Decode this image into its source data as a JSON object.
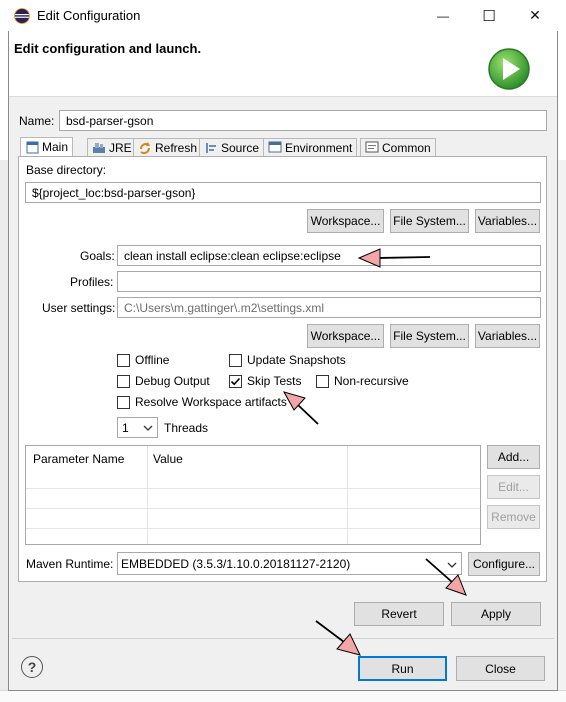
{
  "window": {
    "title": "Edit Configuration",
    "minimize_glyph": "—",
    "maximize_glyph": "☐",
    "close_glyph": "✕"
  },
  "header": {
    "title": "Edit configuration and launch."
  },
  "name": {
    "label": "Name:",
    "value": "bsd-parser-gson"
  },
  "tabs": [
    {
      "label": "Main",
      "icon": "main-tab-icon"
    },
    {
      "label": "JRE",
      "icon": "jre-icon"
    },
    {
      "label": "Refresh",
      "icon": "refresh-icon"
    },
    {
      "label": "Source",
      "icon": "source-icon"
    },
    {
      "label": "Environment",
      "icon": "environment-icon"
    },
    {
      "label": "Common",
      "icon": "common-icon"
    }
  ],
  "base_directory": {
    "label": "Base directory:",
    "value": "${project_loc:bsd-parser-gson}",
    "workspace_btn": "Workspace...",
    "filesystem_btn": "File System...",
    "variables_btn": "Variables..."
  },
  "goals": {
    "label": "Goals:",
    "value": "clean install eclipse:clean eclipse:eclipse"
  },
  "profiles": {
    "label": "Profiles:",
    "value": ""
  },
  "user_settings": {
    "label": "User settings:",
    "value": "C:\\Users\\m.gattinger\\.m2\\settings.xml",
    "workspace_btn": "Workspace...",
    "filesystem_btn": "File System...",
    "variables_btn": "Variables..."
  },
  "options": {
    "offline": {
      "label": "Offline",
      "checked": false
    },
    "update_snapshots": {
      "label": "Update Snapshots",
      "checked": false
    },
    "debug_output": {
      "label": "Debug Output",
      "checked": false
    },
    "skip_tests": {
      "label": "Skip Tests",
      "checked": true
    },
    "non_recursive": {
      "label": "Non-recursive",
      "checked": false
    },
    "resolve_workspace": {
      "label": "Resolve Workspace artifacts",
      "checked": false
    },
    "threads_value": "1",
    "threads_label": "Threads"
  },
  "params_table": {
    "columns": [
      "Parameter Name",
      "Value"
    ],
    "add_btn": "Add...",
    "edit_btn": "Edit...",
    "remove_btn": "Remove"
  },
  "runtime": {
    "label": "Maven Runtime:",
    "value": "EMBEDDED (3.5.3/1.10.0.20181127-2120)",
    "configure_btn": "Configure..."
  },
  "actions": {
    "revert_btn": "Revert",
    "apply_btn": "Apply",
    "run_btn": "Run",
    "close_btn": "Close",
    "help_glyph": "?"
  },
  "colors": {
    "annotation_arrow": "#f4a6a6",
    "run_icon_green": "#3fae3a",
    "focus_border": "#0078d7"
  }
}
